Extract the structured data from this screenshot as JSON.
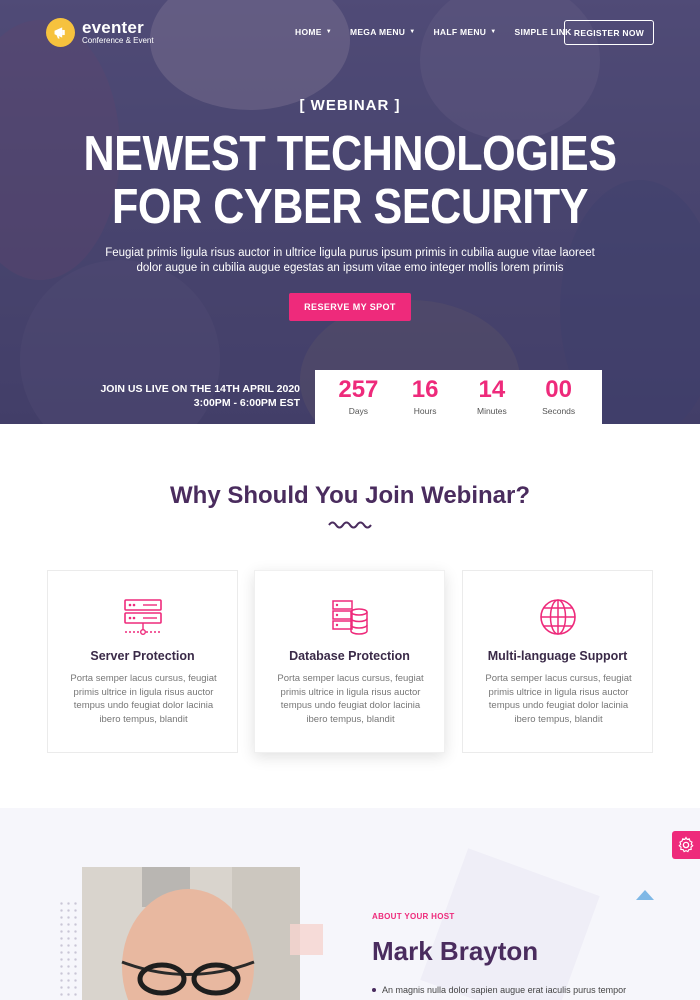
{
  "brand": {
    "name": "eventer",
    "tagline": "Conference & Event"
  },
  "nav": {
    "items": [
      {
        "label": "HOME",
        "dropdown": true
      },
      {
        "label": "MEGA MENU",
        "dropdown": true
      },
      {
        "label": "HALF MENU",
        "dropdown": true
      },
      {
        "label": "SIMPLE LINK",
        "dropdown": false
      }
    ],
    "register_label": "REGISTER NOW"
  },
  "hero": {
    "eyebrow": "[ WEBINAR ]",
    "headline_line1": "NEWEST TECHNOLOGIES",
    "headline_line2": "FOR CYBER SECURITY",
    "subtitle_line1": "Feugiat primis ligula risus auctor in ultrice ligula purus ipsum primis in cubilia augue vitae laoreet",
    "subtitle_line2": "dolor augue in cubilia augue egestas an ipsum vitae emo integer mollis lorem primis",
    "cta_label": "RESERVE MY SPOT",
    "live_line1": "JOIN US LIVE ON THE 14TH APRIL 2020",
    "live_line2": "3:00PM - 6:00PM EST"
  },
  "countdown": [
    {
      "value": "257",
      "label": "Days"
    },
    {
      "value": "16",
      "label": "Hours"
    },
    {
      "value": "14",
      "label": "Minutes"
    },
    {
      "value": "00",
      "label": "Seconds"
    }
  ],
  "why": {
    "title": "Why Should You Join Webinar?",
    "cards": [
      {
        "icon": "server-icon",
        "title": "Server Protection",
        "text": "Porta semper lacus cursus, feugiat primis ultrice in ligula risus auctor tempus undo feugiat dolor lacinia ibero tempus, blandit"
      },
      {
        "icon": "database-icon",
        "title": "Database Protection",
        "text": "Porta semper lacus cursus, feugiat primis ultrice in ligula risus auctor tempus undo feugiat dolor lacinia ibero tempus, blandit"
      },
      {
        "icon": "globe-icon",
        "title": "Multi-language Support",
        "text": "Porta semper lacus cursus, feugiat primis ultrice in ligula risus auctor tempus undo feugiat dolor lacinia ibero tempus, blandit"
      }
    ]
  },
  "host": {
    "eyebrow": "ABOUT YOUR HOST",
    "name": "Mark Brayton",
    "bullet": "An magnis nulla dolor sapien augue erat iaculis purus tempor"
  },
  "colors": {
    "accent": "#ee2a7b",
    "heading": "#4a2c5e",
    "hero_overlay": "#3a3462",
    "logo": "#f6c23e"
  }
}
